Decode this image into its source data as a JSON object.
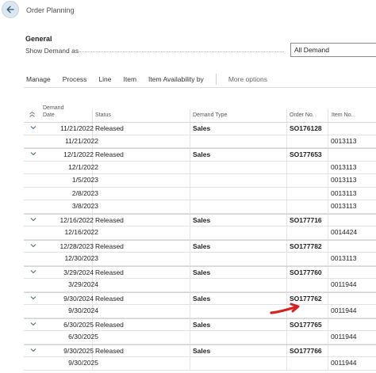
{
  "page": {
    "title": "Order Planning"
  },
  "general": {
    "section_title": "General",
    "show_demand_label": "Show Demand as",
    "show_demand_value": "All Demand"
  },
  "actions": [
    "Manage",
    "Process",
    "Line",
    "Item",
    "Item Availability by",
    "More options"
  ],
  "columns": {
    "demand_date": "Demand Date",
    "status": "Status",
    "demand_type": "Demand Type",
    "order_no": "Order No.",
    "item_no": "Item No."
  },
  "rows": [
    {
      "kind": "parent",
      "date": "11/21/2022",
      "status": "Released",
      "type": "Sales",
      "order": "SO176128",
      "item": ""
    },
    {
      "kind": "child",
      "date": "11/21/2022",
      "status": "",
      "type": "",
      "order": "",
      "item": "0013113"
    },
    {
      "kind": "parent",
      "date": "12/1/2022",
      "status": "Released",
      "type": "Sales",
      "order": "SO177653",
      "item": ""
    },
    {
      "kind": "child",
      "date": "12/1/2022",
      "status": "",
      "type": "",
      "order": "",
      "item": "0013113"
    },
    {
      "kind": "child",
      "date": "1/5/2023",
      "status": "",
      "type": "",
      "order": "",
      "item": "0013113"
    },
    {
      "kind": "child",
      "date": "2/8/2023",
      "status": "",
      "type": "",
      "order": "",
      "item": "0013113"
    },
    {
      "kind": "child",
      "date": "3/8/2023",
      "status": "",
      "type": "",
      "order": "",
      "item": "0013113"
    },
    {
      "kind": "parent",
      "date": "12/16/2022",
      "status": "Released",
      "type": "Sales",
      "order": "SO177716",
      "item": ""
    },
    {
      "kind": "child",
      "date": "12/16/2022",
      "status": "",
      "type": "",
      "order": "",
      "item": "0014424"
    },
    {
      "kind": "parent",
      "date": "12/28/2023",
      "status": "Released",
      "type": "Sales",
      "order": "SO177782",
      "item": ""
    },
    {
      "kind": "child",
      "date": "12/30/2023",
      "status": "",
      "type": "",
      "order": "",
      "item": "0013113"
    },
    {
      "kind": "parent",
      "date": "3/29/2024",
      "status": "Released",
      "type": "Sales",
      "order": "SO177760",
      "item": ""
    },
    {
      "kind": "child",
      "date": "3/29/2024",
      "status": "",
      "type": "",
      "order": "",
      "item": "0011944"
    },
    {
      "kind": "parent",
      "date": "9/30/2024",
      "status": "Released",
      "type": "Sales",
      "order": "SO177762",
      "item": ""
    },
    {
      "kind": "child",
      "date": "9/30/2024",
      "status": "",
      "type": "",
      "order": "",
      "item": "0011944"
    },
    {
      "kind": "parent",
      "date": "6/30/2025",
      "status": "Released",
      "type": "Sales",
      "order": "SO177765",
      "item": ""
    },
    {
      "kind": "child",
      "date": "6/30/2025",
      "status": "",
      "type": "",
      "order": "",
      "item": "0011944"
    },
    {
      "kind": "parent",
      "date": "9/30/2025",
      "status": "Released",
      "type": "Sales",
      "order": "SO177766",
      "item": ""
    },
    {
      "kind": "child",
      "date": "9/30/2025",
      "status": "",
      "type": "",
      "order": "",
      "item": "0011944"
    }
  ],
  "colors": {
    "accent": "#4a6a84",
    "annotation_arrow": "#d92020"
  },
  "icons": {
    "back": "back-arrow-icon",
    "expand": "chevron-down-icon",
    "sort": "sort-up-icon"
  }
}
